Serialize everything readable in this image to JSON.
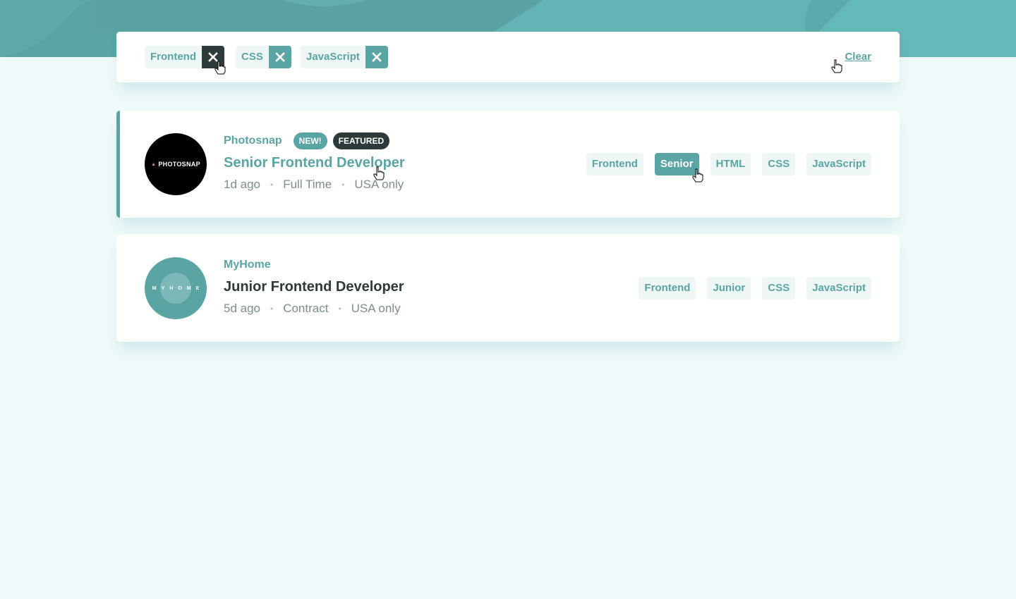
{
  "filters": {
    "chips": [
      {
        "label": "Frontend"
      },
      {
        "label": "CSS"
      },
      {
        "label": "JavaScript"
      }
    ],
    "clear_label": "Clear"
  },
  "jobs": [
    {
      "company": "Photosnap",
      "logo_text": "PHOTOSNAP",
      "new_label": "NEW!",
      "featured_label": "FEATURED",
      "position": "Senior Frontend Developer",
      "posted": "1d ago",
      "contract": "Full Time",
      "location": "USA only",
      "tags": [
        "Frontend",
        "Senior",
        "HTML",
        "CSS",
        "JavaScript"
      ]
    },
    {
      "company": "MyHome",
      "logo_text": "MYHOME",
      "position": "Junior Frontend Developer",
      "posted": "5d ago",
      "contract": "Contract",
      "location": "USA only",
      "tags": [
        "Frontend",
        "Junior",
        "CSS",
        "JavaScript"
      ]
    }
  ],
  "colors": {
    "primary": "#5ba4a4",
    "background": "#effafa",
    "tag_bg": "#eef6f6",
    "dark": "#2c3a3a"
  }
}
